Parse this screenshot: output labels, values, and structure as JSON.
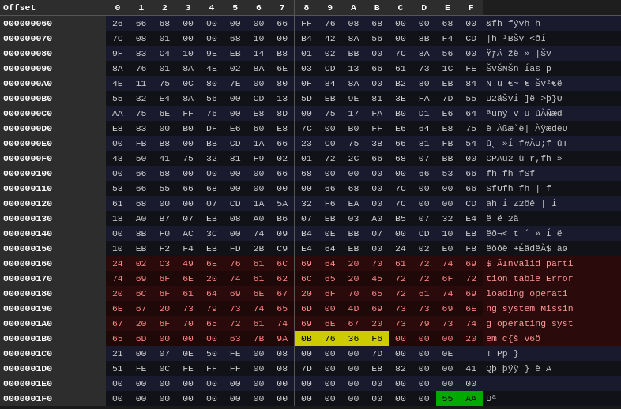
{
  "header": {
    "offset_label": "Offset",
    "columns": [
      "0",
      "1",
      "2",
      "3",
      "4",
      "5",
      "6",
      "7",
      "8",
      "9",
      "A",
      "B",
      "C",
      "D",
      "E",
      "F"
    ]
  },
  "rows": [
    {
      "offset": "000000060",
      "bytes": [
        "26",
        "66",
        "68",
        "00",
        "00",
        "00",
        "00",
        "66",
        "FF",
        "76",
        "08",
        "68",
        "00",
        "00",
        "68",
        "00"
      ],
      "ascii": "&fh  fývh h",
      "highlight_bytes": [],
      "ascii_highlight": false
    },
    {
      "offset": "000000070",
      "bytes": [
        "7C",
        "08",
        "01",
        "00",
        "00",
        "68",
        "10",
        "00",
        "B4",
        "42",
        "8A",
        "56",
        "00",
        "8B",
        "F4",
        "CD"
      ],
      "ascii": "|h  ¹BŠV <ðÍ",
      "highlight_bytes": [],
      "ascii_highlight": false
    },
    {
      "offset": "000000080",
      "bytes": [
        "9F",
        "83",
        "C4",
        "10",
        "9E",
        "EB",
        "14",
        "B8",
        "01",
        "02",
        "BB",
        "00",
        "7C",
        "8A",
        "56",
        "00"
      ],
      "ascii": "ŸƒÄ žë »  |ŠV",
      "highlight_bytes": [],
      "ascii_highlight": false
    },
    {
      "offset": "000000090",
      "bytes": [
        "8A",
        "76",
        "01",
        "8A",
        "4E",
        "02",
        "8A",
        "6E",
        "03",
        "CD",
        "13",
        "66",
        "61",
        "73",
        "1C",
        "FE"
      ],
      "ascii": "ŠvŠNŠn Ías p",
      "highlight_bytes": [],
      "ascii_highlight": false
    },
    {
      "offset": "0000000A0",
      "bytes": [
        "4E",
        "11",
        "75",
        "0C",
        "80",
        "7E",
        "00",
        "80",
        "0F",
        "84",
        "8A",
        "00",
        "B2",
        "80",
        "EB",
        "84"
      ],
      "ascii": "N u €~ € ŠV²€ë",
      "highlight_bytes": [],
      "ascii_highlight": false
    },
    {
      "offset": "0000000B0",
      "bytes": [
        "55",
        "32",
        "E4",
        "8A",
        "56",
        "00",
        "CD",
        "13",
        "5D",
        "EB",
        "9E",
        "81",
        "3E",
        "FA",
        "7D",
        "55"
      ],
      "ascii": "U2äŠVÍ ]ë >þ}U",
      "highlight_bytes": [],
      "ascii_highlight": false
    },
    {
      "offset": "0000000C0",
      "bytes": [
        "AA",
        "75",
        "6E",
        "FF",
        "76",
        "00",
        "E8",
        "8D",
        "00",
        "75",
        "17",
        "FA",
        "B0",
        "D1",
        "E6",
        "64"
      ],
      "ascii": "ªuný v  u úÀÑæd",
      "highlight_bytes": [],
      "ascii_highlight": false
    },
    {
      "offset": "0000000D0",
      "bytes": [
        "E8",
        "83",
        "00",
        "B0",
        "DF",
        "E6",
        "60",
        "E8",
        "7C",
        "00",
        "B0",
        "FF",
        "E6",
        "64",
        "E8",
        "75"
      ],
      "ascii": "è Àßæ`è| ÀÿædèU",
      "highlight_bytes": [],
      "ascii_highlight": false
    },
    {
      "offset": "0000000E0",
      "bytes": [
        "00",
        "FB",
        "B8",
        "00",
        "BB",
        "CD",
        "1A",
        "66",
        "23",
        "C0",
        "75",
        "3B",
        "66",
        "81",
        "FB",
        "54"
      ],
      "ascii": "û¸ »Í f#ÀU;f ûT",
      "highlight_bytes": [],
      "ascii_highlight": false
    },
    {
      "offset": "0000000F0",
      "bytes": [
        "43",
        "50",
        "41",
        "75",
        "32",
        "81",
        "F9",
        "02",
        "01",
        "72",
        "2C",
        "66",
        "68",
        "07",
        "BB",
        "00"
      ],
      "ascii": "CPAu2 ù  r,fh »",
      "highlight_bytes": [],
      "ascii_highlight": false
    },
    {
      "offset": "000000100",
      "bytes": [
        "00",
        "66",
        "68",
        "00",
        "00",
        "00",
        "00",
        "66",
        "68",
        "00",
        "00",
        "00",
        "00",
        "66",
        "53",
        "66"
      ],
      "ascii": "fh   fh   fSf",
      "highlight_bytes": [],
      "ascii_highlight": false
    },
    {
      "offset": "000000110",
      "bytes": [
        "53",
        "66",
        "55",
        "66",
        "68",
        "00",
        "00",
        "00",
        "00",
        "66",
        "68",
        "00",
        "7C",
        "00",
        "00",
        "66"
      ],
      "ascii": "SfUfh   fh |  f",
      "highlight_bytes": [],
      "ascii_highlight": false
    },
    {
      "offset": "000000120",
      "bytes": [
        "61",
        "68",
        "00",
        "00",
        "07",
        "CD",
        "1A",
        "5A",
        "32",
        "F6",
        "EA",
        "00",
        "7C",
        "00",
        "00",
        "CD"
      ],
      "ascii": "ah   Í Z2öê |  Í",
      "highlight_bytes": [],
      "ascii_highlight": false
    },
    {
      "offset": "000000130",
      "bytes": [
        "18",
        "A0",
        "B7",
        "07",
        "EB",
        "08",
        "A0",
        "B6",
        "07",
        "EB",
        "03",
        "A0",
        "B5",
        "07",
        "32",
        "E4"
      ],
      "ascii": " ë  ë  2ä",
      "highlight_bytes": [],
      "ascii_highlight": false
    },
    {
      "offset": "000000140",
      "bytes": [
        "00",
        "8B",
        "F0",
        "AC",
        "3C",
        "00",
        "74",
        "09",
        "B4",
        "0E",
        "BB",
        "07",
        "00",
        "CD",
        "10",
        "EB"
      ],
      "ascii": "ëð¬< t ´ » Í ë",
      "highlight_bytes": [],
      "ascii_highlight": false
    },
    {
      "offset": "000000150",
      "bytes": [
        "10",
        "EB",
        "F2",
        "F4",
        "EB",
        "FD",
        "2B",
        "C9",
        "E4",
        "64",
        "EB",
        "00",
        "24",
        "02",
        "E0",
        "F8"
      ],
      "ascii": "ëòôë +ÉädëÀ$ àø",
      "highlight_bytes": [],
      "ascii_highlight": false
    },
    {
      "offset": "000000160",
      "bytes": [
        "24",
        "02",
        "C3",
        "49",
        "6E",
        "76",
        "61",
        "6C",
        "69",
        "64",
        "20",
        "70",
        "61",
        "72",
        "74",
        "69"
      ],
      "ascii": "$ ÃInvalid parti",
      "highlight_bytes": [],
      "ascii_highlight": true
    },
    {
      "offset": "000000170",
      "bytes": [
        "74",
        "69",
        "6F",
        "6E",
        "20",
        "74",
        "61",
        "62",
        "6C",
        "65",
        "20",
        "45",
        "72",
        "72",
        "6F",
        "72"
      ],
      "ascii": "tion table Error",
      "highlight_bytes": [],
      "ascii_highlight": true
    },
    {
      "offset": "000000180",
      "bytes": [
        "20",
        "6C",
        "6F",
        "61",
        "64",
        "69",
        "6E",
        "67",
        "20",
        "6F",
        "70",
        "65",
        "72",
        "61",
        "74",
        "69"
      ],
      "ascii": " loading operati",
      "highlight_bytes": [],
      "ascii_highlight": true
    },
    {
      "offset": "000000190",
      "bytes": [
        "6E",
        "67",
        "20",
        "73",
        "79",
        "73",
        "74",
        "65",
        "6D",
        "00",
        "4D",
        "69",
        "73",
        "73",
        "69",
        "6E"
      ],
      "ascii": "ng system Missin",
      "highlight_bytes": [],
      "ascii_highlight": true
    },
    {
      "offset": "0000001A0",
      "bytes": [
        "67",
        "20",
        "6F",
        "70",
        "65",
        "72",
        "61",
        "74",
        "69",
        "6E",
        "67",
        "20",
        "73",
        "79",
        "73",
        "74"
      ],
      "ascii": "g operating syst",
      "highlight_bytes": [],
      "ascii_highlight": true
    },
    {
      "offset": "0000001B0",
      "bytes": [
        "65",
        "6D",
        "00",
        "00",
        "00",
        "63",
        "7B",
        "9A",
        "0B",
        "76",
        "36",
        "F6",
        "00",
        "00",
        "00",
        "20"
      ],
      "ascii": "em  c{š v6ö   ",
      "highlight_bytes": [
        8,
        9,
        10,
        11
      ],
      "ascii_highlight": true
    },
    {
      "offset": "0000001C0",
      "bytes": [
        "21",
        "00",
        "07",
        "0E",
        "50",
        "FE",
        "00",
        "08",
        "00",
        "00",
        "00",
        "7D",
        "00",
        "00",
        "0E",
        ""
      ],
      "ascii": "!  Pp }  ",
      "highlight_bytes": [],
      "ascii_highlight": false
    },
    {
      "offset": "0000001D0",
      "bytes": [
        "51",
        "FE",
        "0C",
        "FE",
        "FF",
        "FF",
        "00",
        "08",
        "7D",
        "00",
        "00",
        "E8",
        "82",
        "00",
        "00",
        "41"
      ],
      "ascii": "Qþ þÿÿ } è  A",
      "highlight_bytes": [],
      "ascii_highlight": false
    },
    {
      "offset": "0000001E0",
      "bytes": [
        "00",
        "00",
        "00",
        "00",
        "00",
        "00",
        "00",
        "00",
        "00",
        "00",
        "00",
        "00",
        "00",
        "00",
        "00",
        "00"
      ],
      "ascii": "                ",
      "highlight_bytes": [],
      "ascii_highlight": false
    },
    {
      "offset": "0000001F0",
      "bytes": [
        "00",
        "00",
        "00",
        "00",
        "00",
        "00",
        "00",
        "00",
        "00",
        "00",
        "00",
        "00",
        "00",
        "00",
        "55",
        "AA"
      ],
      "ascii": "              Uª",
      "highlight_bytes": [
        14,
        15
      ],
      "ascii_highlight": false
    }
  ]
}
